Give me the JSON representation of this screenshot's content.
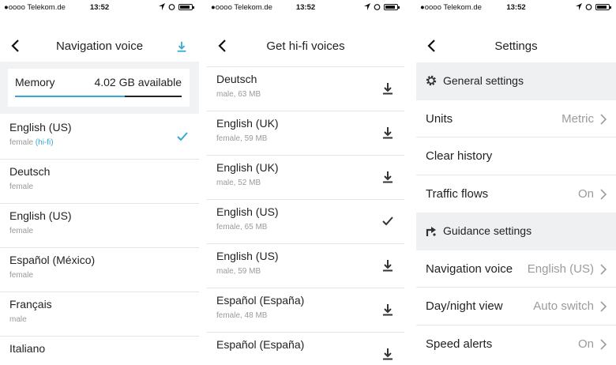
{
  "status": {
    "carrier": "●oooo Telekom.de",
    "time": "13:52"
  },
  "screens": {
    "voice": {
      "title": "Navigation voice",
      "memory": {
        "label": "Memory",
        "available": "4.02 GB available",
        "used_fraction": 0.66
      },
      "voices": [
        {
          "name": "English (US)",
          "detail": "female",
          "hifi": "(hi-fi)",
          "selected": true
        },
        {
          "name": "Deutsch",
          "detail": "female",
          "hifi": "",
          "selected": false
        },
        {
          "name": "English (US)",
          "detail": "female",
          "hifi": "",
          "selected": false
        },
        {
          "name": "Español (México)",
          "detail": "female",
          "hifi": "",
          "selected": false
        },
        {
          "name": "Français",
          "detail": "male",
          "hifi": "",
          "selected": false
        },
        {
          "name": "Italiano",
          "detail": "",
          "hifi": "",
          "selected": false
        }
      ]
    },
    "hifi": {
      "title": "Get hi-fi voices",
      "voices": [
        {
          "name": "Deutsch",
          "detail": "male, 63 MB",
          "state": "download"
        },
        {
          "name": "English (UK)",
          "detail": "female, 59 MB",
          "state": "download"
        },
        {
          "name": "English (UK)",
          "detail": "male, 52 MB",
          "state": "download"
        },
        {
          "name": "English (US)",
          "detail": "female, 65 MB",
          "state": "installed"
        },
        {
          "name": "English (US)",
          "detail": "male, 59 MB",
          "state": "download"
        },
        {
          "name": "Español (España)",
          "detail": "female, 48 MB",
          "state": "download"
        },
        {
          "name": "Español (España)",
          "detail": "",
          "state": "download"
        }
      ]
    },
    "settings": {
      "title": "Settings",
      "general": {
        "title": "General settings",
        "units": {
          "label": "Units",
          "value": "Metric"
        },
        "clear_history": {
          "label": "Clear history"
        },
        "traffic": {
          "label": "Traffic flows",
          "value": "On"
        }
      },
      "guidance": {
        "title": "Guidance settings",
        "nav_voice": {
          "label": "Navigation voice",
          "value": "English (US)"
        },
        "day_night": {
          "label": "Day/night view",
          "value": "Auto switch"
        },
        "speed_alerts": {
          "label": "Speed alerts",
          "value": "On"
        }
      }
    }
  },
  "colors": {
    "accent": "#36a9d4",
    "section_bg": "#eef0f2",
    "muted": "#9b9b9b"
  }
}
